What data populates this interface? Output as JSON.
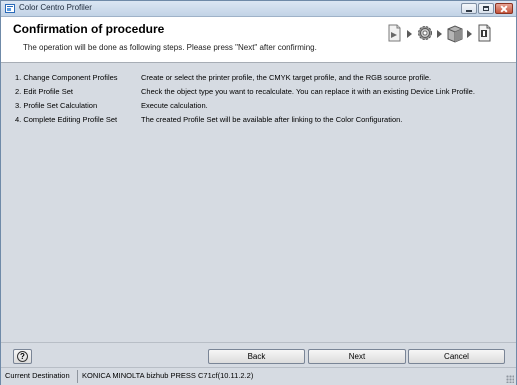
{
  "window": {
    "title": "Color Centro Profiler"
  },
  "header": {
    "title": "Confirmation of procedure",
    "subtitle": "The operation will be done as following steps. Please press \"Next\" after confirming.",
    "step_icons": [
      "document-arrow-icon",
      "gear-icon",
      "package-icon",
      "document-info-icon"
    ]
  },
  "steps": [
    {
      "name": "1. Change Component Profiles",
      "description": "Create or select the printer profile, the CMYK target profile, and the RGB source profile."
    },
    {
      "name": "2. Edit Profile Set",
      "description": "Check the object type you want to recalculate. You can replace it with an existing Device Link Profile."
    },
    {
      "name": "3. Profile Set Calculation",
      "description": "Execute calculation."
    },
    {
      "name": "4. Complete Editing Profile Set",
      "description": "The created Profile Set will be available after linking to the Color Configuration."
    }
  ],
  "buttons": {
    "help": "?",
    "back": "Back",
    "next": "Next",
    "cancel": "Cancel"
  },
  "status": {
    "label": "Current Destination",
    "value": "KONICA MINOLTA bizhub PRESS C71cf(10.11.2.2)"
  }
}
